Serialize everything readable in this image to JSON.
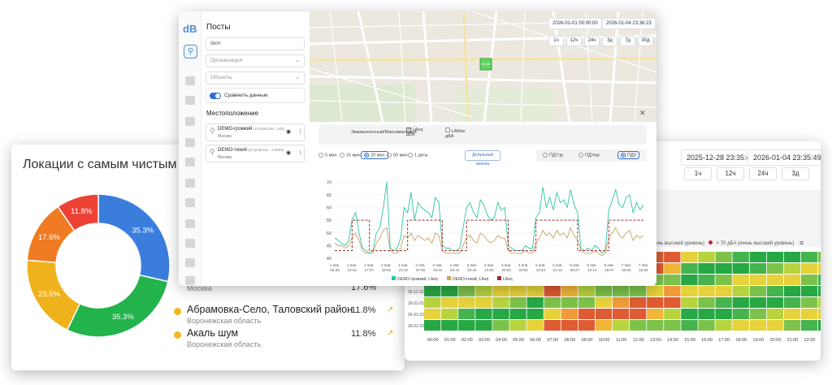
{
  "donut": {
    "title": "Локации с самым чистым возд",
    "slices": [
      {
        "label": "35.3%",
        "value": 35.3,
        "color": "#3b7ddd"
      },
      {
        "label": "35.3%",
        "value": 35.3,
        "color": "#22b34c"
      },
      {
        "label": "23.5%",
        "value": 23.5,
        "color": "#f0b21c"
      },
      {
        "label": "17.6%",
        "value": 17.6,
        "color": "#f07b22"
      },
      {
        "label": "11.8%",
        "value": 11.8,
        "color": "#ec4236"
      }
    ],
    "locations": [
      {
        "name": "",
        "region": "Москва",
        "pct": "17.6%"
      },
      {
        "name": "Абрамовка-Село, Таловский район",
        "region": "Воронежская область",
        "pct": "11.8%"
      },
      {
        "name": "Акаль шум",
        "region": "Воронежская область",
        "pct": "11.8%"
      }
    ]
  },
  "table_panel": {
    "date_from": "2025-12-28 23:35:49",
    "date_to": "2026-01-04 23:35:49",
    "ranges": [
      "1ч",
      "12ч",
      "24ч",
      "3д"
    ],
    "legend_text": "(очень высокий уровень)",
    "legend_red": "> 70 дБА (очень высокий уровень)",
    "hours": [
      "00:00",
      "01:00",
      "02:00",
      "03:00",
      "04:00",
      "05:00",
      "06:00",
      "07:00",
      "08:00",
      "09:00",
      "10:00",
      "11:00",
      "12:00",
      "13:00",
      "14:00",
      "15:00",
      "16:00",
      "17:00",
      "18:00",
      "19:00",
      "20:00",
      "21:00",
      "22:00",
      "23:00"
    ],
    "row_dates": [
      "25-12-28",
      "25-12-29",
      "25-12-30",
      "25-12-31",
      "26-01-01",
      "26-01-02",
      "26-01-03"
    ]
  },
  "main": {
    "logo": "dB",
    "panel_title": "Посты",
    "search_value": "dem",
    "org_placeholder": "Организация",
    "obj_placeholder": "Объекты",
    "compare_label": "Сравнить данные",
    "location_title": "Местоположение",
    "posts": [
      {
        "name": "DEMO-громкий",
        "tag": "(Устройство - 203)",
        "city": "Москва"
      },
      {
        "name": "DEMO-тихий",
        "tag": "(Устройство - C0802)",
        "city": "Москва"
      }
    ],
    "date_from": "2026-01-01 00:00:00",
    "date_to": "2026-01-04 23:36:23",
    "range_buttons": [
      "1ч",
      "12ч",
      "24ч",
      "3д",
      "7д",
      "30д"
    ],
    "map_marker": "65,88",
    "metric_header": "Эквивалентный/Максимальный",
    "metrics": [
      {
        "name": "LAeq",
        "unit": "дБА",
        "checked": true
      },
      {
        "name": "LAMax",
        "unit": "дБА",
        "checked": false
      }
    ],
    "intervals": [
      "5 мин",
      "15 мин",
      "20 мин",
      "60 мин",
      "1 день"
    ],
    "selected_interval": "20 мин",
    "detail_button": "Детальный анализ",
    "norm_options": [
      "ПДУэр",
      "ПДУмр",
      "ПДУ"
    ],
    "selected_norm": "ПДУ"
  },
  "chart_data": {
    "type": "line",
    "ylim": [
      40,
      72
    ],
    "yticks": [
      40,
      45,
      50,
      55,
      60,
      65,
      70
    ],
    "xticks": [
      {
        "l1": "1 янв.",
        "l2": "02:33"
      },
      {
        "l1": "1 янв.",
        "l2": "10:13"
      },
      {
        "l1": "1 янв.",
        "l2": "17:27"
      },
      {
        "l1": "1 янв.",
        "l2": "19:02"
      },
      {
        "l1": "1 янв.",
        "l2": "21:22"
      },
      {
        "l1": "2 янв.",
        "l2": "07:46"
      },
      {
        "l1": "2 янв.",
        "l2": "15:31"
      },
      {
        "l1": "2 янв.",
        "l2": "20:41"
      },
      {
        "l1": "3 янв.",
        "l2": "02:41"
      },
      {
        "l1": "3 янв.",
        "l2": "10:01"
      },
      {
        "l1": "3 янв.",
        "l2": "20:03"
      },
      {
        "l1": "4 янв.",
        "l2": "23:51"
      },
      {
        "l1": "5 янв.",
        "l2": "13:43"
      },
      {
        "l1": "5 янв.",
        "l2": "21:12"
      },
      {
        "l1": "6 янв.",
        "l2": "06:27"
      },
      {
        "l1": "6 янв.",
        "l2": "12:14"
      },
      {
        "l1": "6 янв.",
        "l2": "18:07"
      },
      {
        "l1": "7 янв.",
        "l2": "03:03"
      },
      {
        "l1": "7 янв.",
        "l2": "16:34"
      }
    ],
    "series": [
      {
        "name": "DEMO-громкий, LAeq",
        "color": "#2cc4a8",
        "values": [
          48,
          47,
          46,
          45,
          47,
          55,
          58,
          50,
          44,
          43,
          42,
          43,
          50,
          52,
          60,
          70,
          44,
          43,
          44,
          48,
          60,
          58,
          66,
          55,
          62,
          60,
          59,
          58,
          56,
          64,
          62,
          45,
          44,
          44,
          43,
          43,
          44,
          52,
          60,
          62,
          58,
          56,
          63,
          61,
          57,
          55,
          56,
          62,
          59,
          60,
          45,
          44,
          43,
          43,
          43,
          45,
          44,
          44,
          56,
          58,
          68,
          60,
          64,
          59,
          66,
          62,
          63,
          60,
          67,
          61,
          58,
          44,
          43,
          44,
          43,
          45,
          44,
          42,
          43,
          59,
          63,
          67,
          61,
          60,
          64,
          65,
          58,
          62,
          59,
          61
        ]
      },
      {
        "name": "DEMO-тихий, LAeq",
        "color": "#c7a35a",
        "values": [
          46,
          45,
          45,
          44,
          45,
          48,
          50,
          47,
          43,
          42,
          42,
          42,
          46,
          48,
          51,
          52,
          43,
          42,
          42,
          44,
          49,
          48,
          50,
          47,
          49,
          48,
          47,
          48,
          46,
          50,
          49,
          43,
          42,
          42,
          42,
          42,
          42,
          45,
          48,
          49,
          47,
          46,
          50,
          49,
          47,
          46,
          47,
          49,
          48,
          48,
          43,
          42,
          42,
          42,
          42,
          43,
          42,
          42,
          46,
          48,
          51,
          49,
          50,
          48,
          51,
          49,
          50,
          48,
          52,
          49,
          47,
          43,
          42,
          42,
          42,
          43,
          42,
          41,
          42,
          48,
          50,
          52,
          49,
          48,
          50,
          51,
          47,
          49,
          48,
          49
        ]
      },
      {
        "name": "LAeq",
        "color": "#9b2a2a",
        "dashed": true,
        "values": [
          43,
          43,
          43,
          43,
          43,
          55,
          55,
          55,
          55,
          55,
          43,
          43,
          43,
          43,
          43,
          43,
          43,
          43,
          43,
          43,
          43,
          55,
          55,
          55,
          55,
          55,
          55,
          55,
          55,
          55,
          55,
          43,
          43,
          43,
          43,
          43,
          43,
          43,
          55,
          55,
          55,
          55,
          55,
          55,
          55,
          55,
          55,
          55,
          55,
          55,
          43,
          43,
          43,
          43,
          43,
          43,
          43,
          43,
          55,
          55,
          55,
          55,
          55,
          55,
          55,
          55,
          55,
          55,
          55,
          55,
          43,
          43,
          43,
          43,
          43,
          43,
          43,
          43,
          43,
          55,
          55,
          55,
          55,
          55,
          55,
          55,
          55,
          55,
          55,
          55
        ]
      }
    ],
    "legend": [
      "DEMO-громкий, LAeq",
      "DEMO-тихий, LAeq",
      "LAeq"
    ]
  }
}
